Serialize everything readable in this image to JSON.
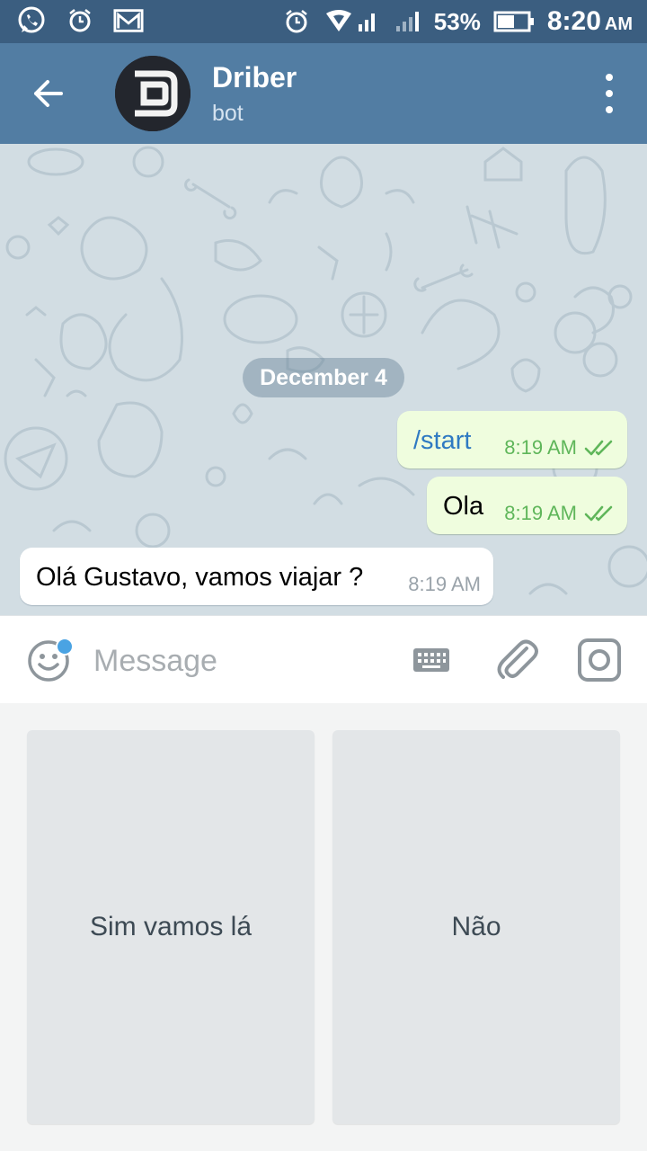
{
  "status_bar": {
    "battery_percent": "53%",
    "time": "8:20",
    "ampm": "AM",
    "left_icons": [
      "whatsapp-icon",
      "alarm-icon",
      "gmail-icon"
    ],
    "right_icons": [
      "alarm-icon",
      "wifi-icon",
      "signal-icon",
      "signal-icon",
      "battery-icon"
    ]
  },
  "header": {
    "title": "Driber",
    "subtitle": "bot"
  },
  "chat": {
    "date_separator": "December 4",
    "messages": [
      {
        "direction": "out",
        "text": "/start",
        "time": "8:19 AM",
        "status": "read",
        "is_command": true
      },
      {
        "direction": "out",
        "text": "Ola",
        "time": "8:19 AM",
        "status": "read",
        "is_command": false
      },
      {
        "direction": "in",
        "text": "Olá Gustavo, vamos viajar ?",
        "time": "8:19 AM"
      }
    ]
  },
  "input": {
    "placeholder": "Message",
    "value": ""
  },
  "bot_keyboard": {
    "buttons": [
      {
        "label": "Sim vamos lá"
      },
      {
        "label": "Não"
      }
    ]
  },
  "colors": {
    "status_bar": "#3b5e80",
    "header": "#527da3",
    "chat_background": "#d2dde3",
    "outgoing_bubble": "#effdde",
    "incoming_bubble": "#ffffff",
    "read_checks": "#5fb65a",
    "command_link": "#2f7ac2",
    "keyboard_key": "#e3e6e8"
  }
}
